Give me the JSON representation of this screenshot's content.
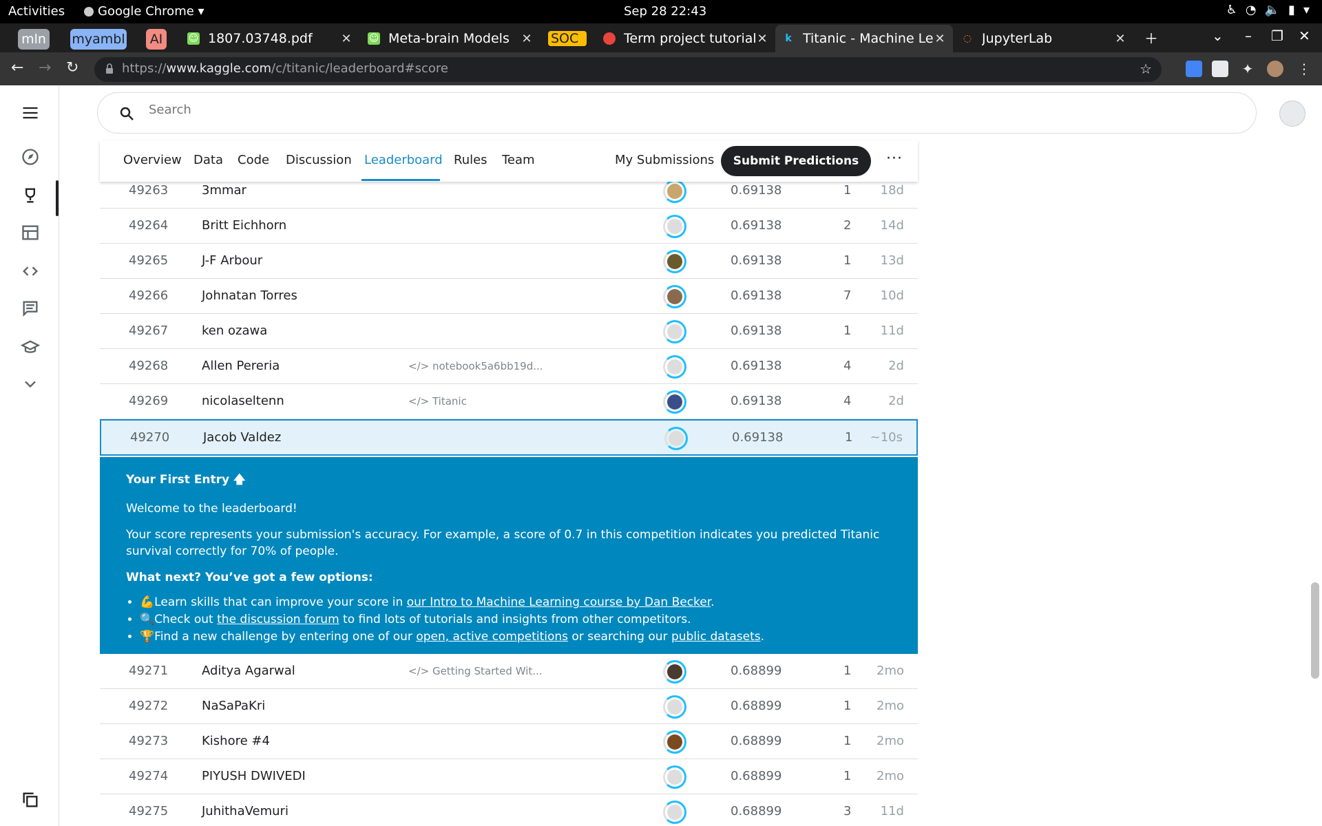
{
  "os": {
    "activities": "Activities",
    "app_menu": "Google Chrome ▾",
    "clock": "Sep 28  22:43"
  },
  "bookmarks": [
    {
      "label": "mln",
      "color": "#9aa0a6"
    },
    {
      "label": "myambl",
      "color": "#8ab4f8"
    },
    {
      "label": "AI",
      "color": "#f28b82"
    }
  ],
  "tabs": [
    {
      "title": "1807.03748.pdf"
    },
    {
      "title": "Meta-brain Models"
    },
    {
      "title": "SOC"
    },
    {
      "title": "Term project tutorial"
    },
    {
      "title": "Titanic - Machine Lea"
    },
    {
      "title": "JupyterLab"
    }
  ],
  "address": {
    "url_prefix": "https://",
    "url_host": "www.kaggle.com",
    "url_path": "/c/titanic/leaderboard#score"
  },
  "search": {
    "placeholder": "Search"
  },
  "comp_tabs": [
    "Overview",
    "Data",
    "Code",
    "Discussion",
    "Leaderboard",
    "Rules",
    "Team"
  ],
  "my_submissions": "My Submissions",
  "submit_predictions": "Submit Predictions",
  "more": "···",
  "rows_top": [
    {
      "rank": "49263",
      "team": "3mmar",
      "notebook": "",
      "score": "0.69138",
      "entries": "1",
      "last": "18d"
    },
    {
      "rank": "49264",
      "team": "Britt Eichhorn",
      "notebook": "",
      "score": "0.69138",
      "entries": "2",
      "last": "14d"
    },
    {
      "rank": "49265",
      "team": "J-F Arbour",
      "notebook": "",
      "score": "0.69138",
      "entries": "1",
      "last": "13d"
    },
    {
      "rank": "49266",
      "team": "Johnatan Torres",
      "notebook": "",
      "score": "0.69138",
      "entries": "7",
      "last": "10d"
    },
    {
      "rank": "49267",
      "team": "ken ozawa",
      "notebook": "",
      "score": "0.69138",
      "entries": "1",
      "last": "11d"
    },
    {
      "rank": "49268",
      "team": "Allen Pereria",
      "notebook": "</> notebook5a6bb19d...",
      "score": "0.69138",
      "entries": "4",
      "last": "2d"
    },
    {
      "rank": "49269",
      "team": "nicolaseltenn",
      "notebook": "</> Titanic",
      "score": "0.69138",
      "entries": "4",
      "last": "2d"
    },
    {
      "rank": "49270",
      "team": "Jacob Valdez",
      "notebook": "",
      "score": "0.69138",
      "entries": "1",
      "last": "~10s"
    }
  ],
  "info": {
    "heading": "Your First Entry 🡅",
    "welcome": "Welcome to the leaderboard!",
    "explain": "Your score represents your submission's accuracy. For example, a score of 0.7 in this competition indicates you predicted Titanic survival correctly for 70% of people.",
    "next": "What next? You’ve got a few options:",
    "opt1_pre": "💪Learn skills that can improve your score in ",
    "opt1_link": "our Intro to Machine Learning course by Dan Becker",
    "opt1_post": ".",
    "opt2_pre": "🔍Check out ",
    "opt2_link": "the discussion forum",
    "opt2_post": " to find lots of tutorials and insights from other competitors.",
    "opt3_pre": "🏆Find a new challenge by entering one of our ",
    "opt3_link": "open, active competitions",
    "opt3_mid": " or searching our ",
    "opt3_link2": "public datasets",
    "opt3_post": "."
  },
  "rows_bottom": [
    {
      "rank": "49271",
      "team": "Aditya Agarwal",
      "notebook": "</> Getting Started Wit...",
      "score": "0.68899",
      "entries": "1",
      "last": "2mo"
    },
    {
      "rank": "49272",
      "team": "NaSaPaKri",
      "notebook": "",
      "score": "0.68899",
      "entries": "1",
      "last": "2mo"
    },
    {
      "rank": "49273",
      "team": "Kishore #4",
      "notebook": "",
      "score": "0.68899",
      "entries": "1",
      "last": "2mo"
    },
    {
      "rank": "49274",
      "team": "PIYUSH DWIVEDI",
      "notebook": "",
      "score": "0.68899",
      "entries": "1",
      "last": "2mo"
    },
    {
      "rank": "49275",
      "team": "JuhithaVemuri",
      "notebook": "",
      "score": "0.68899",
      "entries": "3",
      "last": "11d"
    }
  ]
}
